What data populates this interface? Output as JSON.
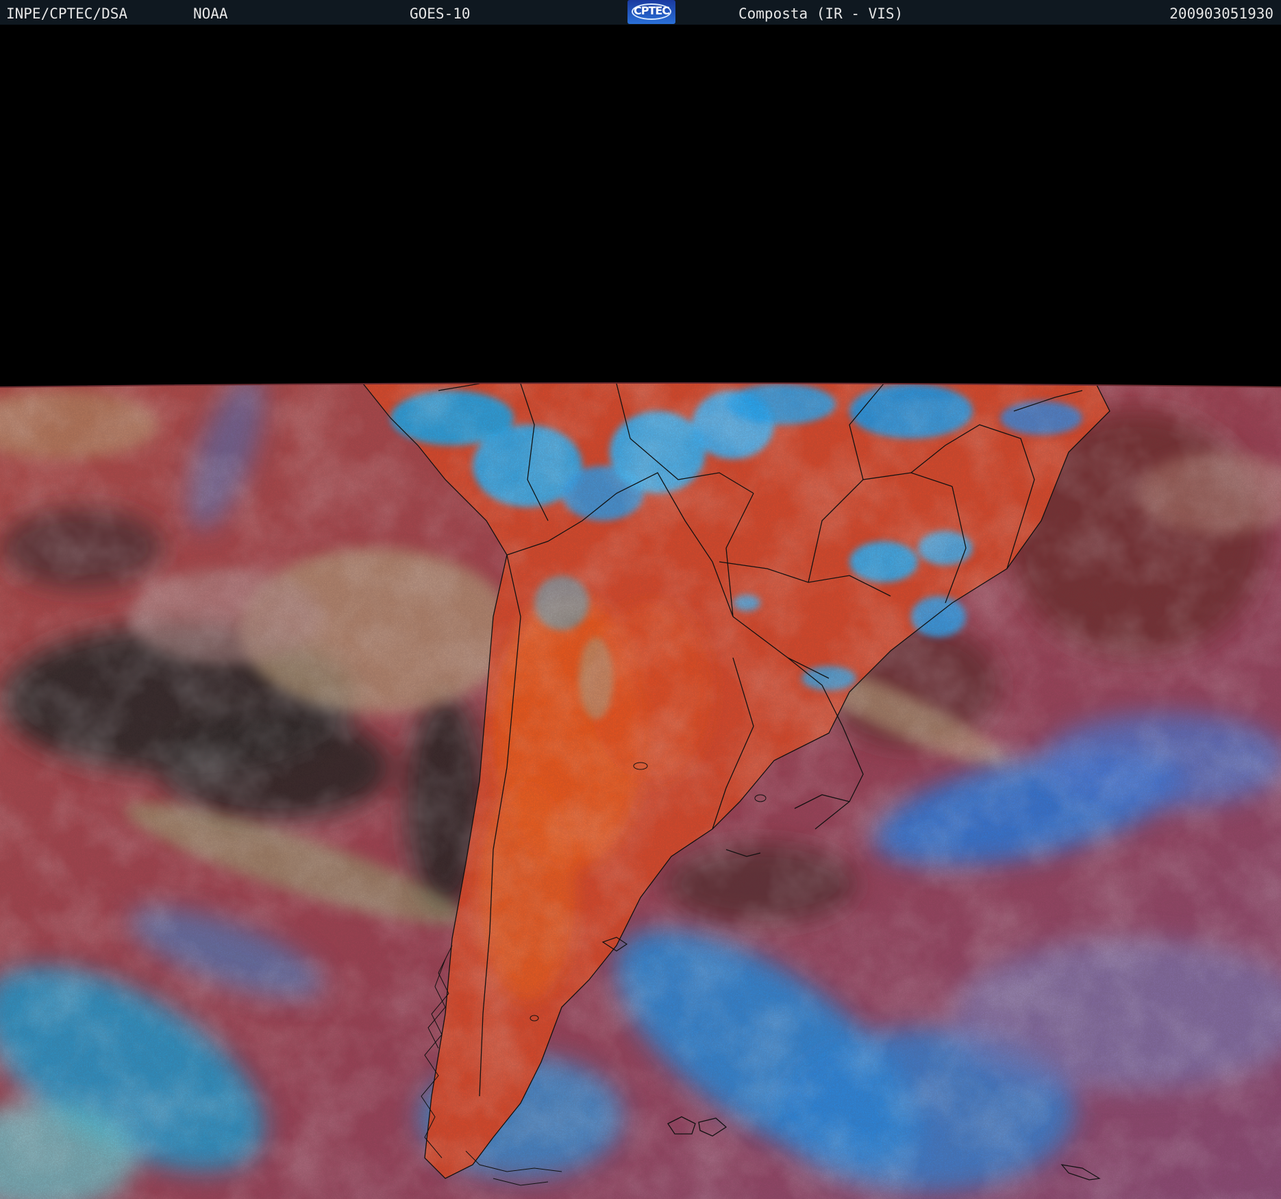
{
  "header": {
    "organization": "INPE/CPTEC/DSA",
    "agency": "NOAA",
    "satellite": "GOES-10",
    "logo_text": "CPTEC",
    "product": "Composta (IR - VIS)",
    "timestamp": "200903051930"
  },
  "colors": {
    "header_bg": "#0f1820",
    "header_text": "#e6e6e6",
    "space": "#000000",
    "ocean_base": "#9a4455",
    "land_clear": "#d8482a",
    "land_hot": "#f05a18",
    "cold_cloud": "#1aa0f0",
    "low_cloud": "#9ab87a",
    "clear_ocean_dark": "#2a2626",
    "border_lines": "#111111"
  }
}
